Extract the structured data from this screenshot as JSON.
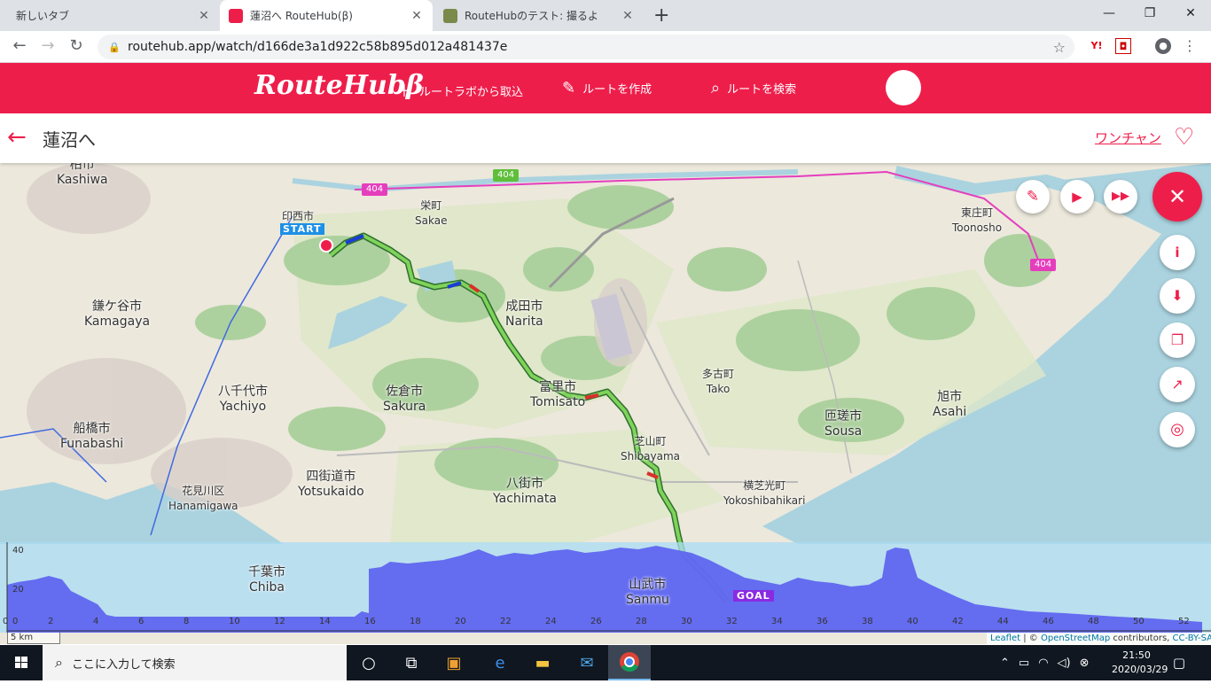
{
  "browser": {
    "tabs": [
      {
        "title": "新しいタブ",
        "active": false
      },
      {
        "title": "蓮沼へ RouteHub(β)",
        "active": true
      },
      {
        "title": "RouteHubのテスト: 撮るよ",
        "active": false
      }
    ],
    "url": "routehub.app/watch/d166de3a1d922c58b895d012a481437e",
    "new_tab_label": "+"
  },
  "app": {
    "logo": "RouteHubβ",
    "nav": [
      {
        "label": "ルートラボから取込",
        "icon": "plus-icon"
      },
      {
        "label": "ルートを作成",
        "icon": "pencil-icon"
      },
      {
        "label": "ルートを検索",
        "icon": "search-icon"
      }
    ],
    "route_title": "蓮沼へ",
    "author": "ワンチャン",
    "accent_color": "#ee1e4b"
  },
  "map": {
    "places": [
      {
        "ja": "柏市",
        "en": "Kashiwa"
      },
      {
        "ja": "栄町",
        "en": "Sakae"
      },
      {
        "ja": "印西市",
        "en": "Inzai"
      },
      {
        "ja": "東庄町",
        "en": "Toonosho"
      },
      {
        "ja": "鎌ケ谷市",
        "en": "Kamagaya"
      },
      {
        "ja": "成田市",
        "en": "Narita"
      },
      {
        "ja": "八千代市",
        "en": "Yachiyo"
      },
      {
        "ja": "佐倉市",
        "en": "Sakura"
      },
      {
        "ja": "富里市",
        "en": "Tomisato"
      },
      {
        "ja": "多古町",
        "en": "Tako"
      },
      {
        "ja": "旭市",
        "en": "Asahi"
      },
      {
        "ja": "船橋市",
        "en": "Funabashi"
      },
      {
        "ja": "匝瑳市",
        "en": "Sousa"
      },
      {
        "ja": "芝山町",
        "en": "Shibayama"
      },
      {
        "ja": "四街道市",
        "en": "Yotsukaido"
      },
      {
        "ja": "花見川区",
        "en": "Hanamigawa"
      },
      {
        "ja": "八街市",
        "en": "Yachimata"
      },
      {
        "ja": "横芝光町",
        "en": "Yokoshibahikari"
      },
      {
        "ja": "千葉市",
        "en": "Chiba"
      },
      {
        "ja": "山武市",
        "en": "Sanmu"
      }
    ],
    "road_number": "404",
    "start_label": "START",
    "goal_label": "GOAL",
    "scale_label": "5 km",
    "attribution": {
      "leaflet": "Leaflet",
      "sep": " | © ",
      "osm": "OpenStreetMap",
      "contrib": " contributors, ",
      "license": "CC-BY-SA"
    },
    "controls": [
      "pencil-icon",
      "play-icon",
      "fast-forward-icon",
      "close-icon",
      "info-icon",
      "download-icon",
      "copy-icon",
      "trending-up-icon",
      "locate-icon"
    ]
  },
  "elevation": {
    "y_ticks": [
      "40",
      "20",
      "0"
    ],
    "x_ticks": [
      "0",
      "2",
      "4",
      "6",
      "8",
      "10",
      "12",
      "14",
      "16",
      "18",
      "20",
      "22",
      "24",
      "26",
      "28",
      "30",
      "32",
      "34",
      "36",
      "38",
      "40",
      "42",
      "44",
      "46",
      "48",
      "50",
      "52"
    ]
  },
  "taskbar": {
    "search_placeholder": "ここに入力して検索",
    "time": "21:50",
    "date": "2020/03/29"
  }
}
